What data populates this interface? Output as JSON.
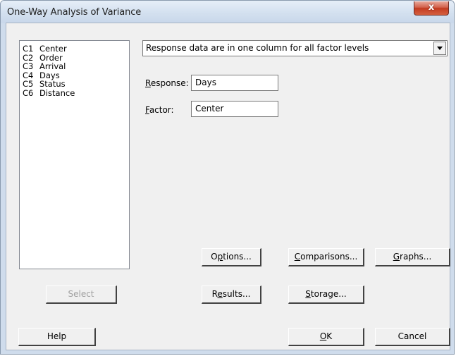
{
  "window": {
    "title": "One-Way Analysis of Variance",
    "close_glyph": "x"
  },
  "variables": [
    {
      "col": "C1",
      "name": "Center"
    },
    {
      "col": "C2",
      "name": "Order"
    },
    {
      "col": "C3",
      "name": "Arrival"
    },
    {
      "col": "C4",
      "name": "Days"
    },
    {
      "col": "C5",
      "name": "Status"
    },
    {
      "col": "C6",
      "name": "Distance"
    }
  ],
  "layout_select": {
    "value": "Response data are in one column for all factor levels"
  },
  "response": {
    "label_u": "R",
    "label_rest": "esponse:",
    "value": "Days"
  },
  "factor": {
    "label_u": "F",
    "label_rest": "actor:",
    "value": "Center"
  },
  "buttons": {
    "options": {
      "pre": "O",
      "u": "p",
      "post": "tions..."
    },
    "comparisons": {
      "pre": "",
      "u": "C",
      "post": "omparisons..."
    },
    "graphs": {
      "pre": "",
      "u": "G",
      "post": "raphs..."
    },
    "select": {
      "label": "Select"
    },
    "results": {
      "pre": "R",
      "u": "e",
      "post": "sults..."
    },
    "storage": {
      "pre": "",
      "u": "S",
      "post": "torage..."
    },
    "help": {
      "label": "Help"
    },
    "ok": {
      "pre": "",
      "u": "O",
      "post": "K"
    },
    "cancel": {
      "label": "Cancel"
    }
  }
}
